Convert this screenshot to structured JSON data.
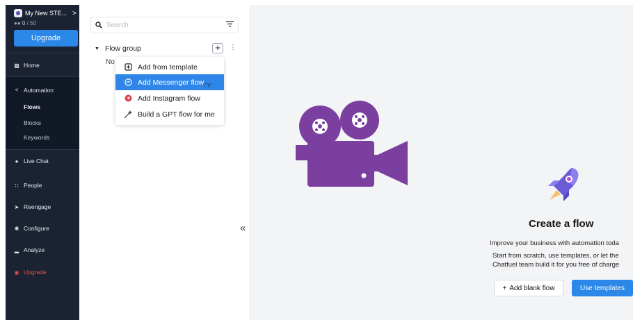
{
  "sidebar": {
    "workspace_name": "My New STE...",
    "workspace_chevron": ">",
    "seats_icon": "people-icon",
    "seats_used": "0",
    "seats_total": "/ 50",
    "upgrade_button": "Upgrade",
    "items": [
      {
        "label": "Home",
        "icon": "home-icon"
      },
      {
        "label": "Automation",
        "icon": "share-icon"
      },
      {
        "label": "Flows"
      },
      {
        "label": "Blocks"
      },
      {
        "label": "Keywords"
      },
      {
        "label": "Live Chat",
        "icon": "chat-icon"
      },
      {
        "label": "People",
        "icon": "people-icon"
      },
      {
        "label": "Reengage",
        "icon": "send-icon"
      },
      {
        "label": "Configure",
        "icon": "gear-icon"
      },
      {
        "label": "Analyze",
        "icon": "bar-chart-icon"
      },
      {
        "label": "Upgrade",
        "icon": "upgrade-icon"
      }
    ],
    "upgrade_color": "#e0534d"
  },
  "flow_panel": {
    "search_placeholder": "Search",
    "group_label": "Flow group",
    "plus_label": "+",
    "kebab_label": "⋮",
    "empty_text": "No"
  },
  "menu": {
    "items": [
      {
        "label": "Add from template",
        "icon": "template-icon"
      },
      {
        "label": "Add Messenger flow",
        "icon": "messenger-icon",
        "highlighted": true
      },
      {
        "label": "Add Instagram flow",
        "icon": "instagram-icon"
      },
      {
        "label": "Build a GPT flow for me",
        "icon": "magic-wand-icon"
      }
    ],
    "highlight_color": "#2f86e8"
  },
  "main": {
    "collapse_label": "«",
    "title": "Create a flow",
    "description": "Improve your business with automation toda",
    "sub_line1": "Start from scratch, use templates, or let the",
    "sub_line2": "Chatfuel team build it for you free of charge",
    "add_blank_label": "Add blank flow",
    "add_blank_plus": "+",
    "use_templates_label": "Use templates",
    "accent_color": "#2b88e8"
  },
  "overlay": {
    "icon": "video-camera-icon",
    "color": "#7b3fa0"
  }
}
